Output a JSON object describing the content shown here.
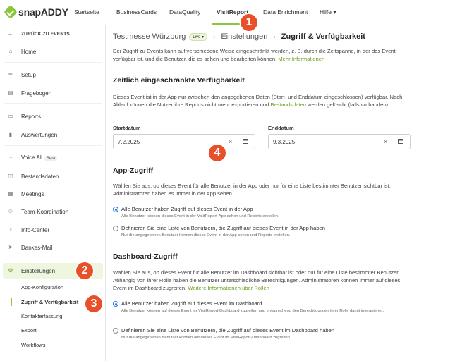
{
  "app": {
    "brand": "snapADDY",
    "accent_color": "#8dc63f",
    "callout_color": "#e8502a"
  },
  "nav": {
    "items": [
      {
        "label": "Startseite"
      },
      {
        "label": "BusinessCards"
      },
      {
        "label": "DataQuality"
      },
      {
        "label": "VisitReport"
      },
      {
        "label": "Data Enrichment"
      },
      {
        "label": "Hilfe ▾"
      }
    ],
    "active": "VisitReport"
  },
  "sidebar": {
    "back": "ZURÜCK ZU EVENTS",
    "items": [
      {
        "label": "Home",
        "icon": "home-icon"
      },
      {
        "label": "Setup",
        "icon": "tools-icon"
      },
      {
        "label": "Fragebogen",
        "icon": "clipboard-icon"
      },
      {
        "label": "Reports",
        "icon": "report-icon"
      },
      {
        "label": "Auswertungen",
        "icon": "bar-chart-icon"
      },
      {
        "label": "Voice AI",
        "icon": "voice-icon",
        "badge": "Beta"
      },
      {
        "label": "Bestandsdaten",
        "icon": "book-icon"
      },
      {
        "label": "Meetings",
        "icon": "calendar-icon"
      },
      {
        "label": "Team-Koordination",
        "icon": "team-icon"
      },
      {
        "label": "Info-Center",
        "icon": "info-pin-icon"
      },
      {
        "label": "Dankes-Mail",
        "icon": "send-icon"
      },
      {
        "label": "Einstellungen",
        "icon": "settings-icon"
      }
    ],
    "sub_items": [
      {
        "label": "App-Konfiguration"
      },
      {
        "label": "Zugriff & Verfügbarkeit"
      },
      {
        "label": "Kontakterfassung"
      },
      {
        "label": "Export"
      },
      {
        "label": "Workflows"
      }
    ]
  },
  "breadcrumb": {
    "event": "Testmesse Würzburg",
    "live_badge": "Live ▾",
    "section": "Einstellungen",
    "current": "Zugriff & Verfügbarkeit"
  },
  "intro": {
    "text": "Der Zugriff zu Events kann auf verschiedene Weise eingeschränkt werden, z. B. durch die Zeitspanne, in der das Event verfügbar ist, und die Benutzer, die es sehen und bearbeiten können.",
    "link": "Mehr Informationen"
  },
  "availability": {
    "heading": "Zeitlich eingeschränkte Verfügbarkeit",
    "text_a": "Dieses Event ist in der App nur zwischen den angegebenen Daten (Start- und Enddatum eingeschlossen) verfügbar. Nach Ablauf können die Nutzer ihre Reports nicht mehr exportieren und",
    "link": "Bestandsdaten",
    "text_b": "werden gelöscht (falls vorhanden).",
    "start_label": "Startdatum",
    "start_value": "7.2.2025",
    "end_label": "Enddatum",
    "end_value": "9.3.2025",
    "clear_symbol": "×"
  },
  "app_access": {
    "heading": "App-Zugriff",
    "text": "Wählen Sie aus, ob dieses Event für alle Benutzer in der App oder nur für eine Liste bestimmter Benutzer sichtbar ist. Administratoren haben es immer in der App sehen.",
    "option_all": {
      "title": "Alle Benutzer haben Zugriff auf dieses Event in der App",
      "sub": "Alle Benutzer können dieses Event in der VisitReport-App sehen und Reports erstellen.",
      "selected": true
    },
    "option_list": {
      "title": "Definieren Sie eine Liste von Benutzern, die Zugriff auf dieses Event in der App haben",
      "sub": "Nur die angegebenen Benutzer können dieses Event in der App sehen und Reports erstellen.",
      "selected": false
    }
  },
  "dashboard_access": {
    "heading": "Dashboard-Zugriff",
    "text": "Wählen Sie aus, ob dieses Event für alle Benutzer im Dashboard sichtbar ist oder nur für eine Liste bestimmter Benutzer. Abhängig von ihrer Rolle haben die Benutzer unterschiedliche Berechtigungen. Administratoren können immer auf dieses Event im Dashboard zugreifen.",
    "link": "Weitere Informationen über Rollen",
    "option_all": {
      "title": "Alle Benutzer haben Zugriff auf dieses Event im Dashboard",
      "sub": "Alle Benutzer können auf dieses Event im VisitReport-Dashboard zugreifen und entsprechend den Berechtigungen ihrer Rolle damit interagieren.",
      "selected": true
    },
    "option_list": {
      "title": "Definieren Sie eine Liste von Benutzern, die Zugriff auf dieses Event im Dashboard haben",
      "sub": "Nur die angegebenen Benutzer können auf dieses Event im VisitReport-Dashboard zugreifen.",
      "selected": false
    }
  },
  "callouts": [
    "1",
    "2",
    "3",
    "4"
  ]
}
